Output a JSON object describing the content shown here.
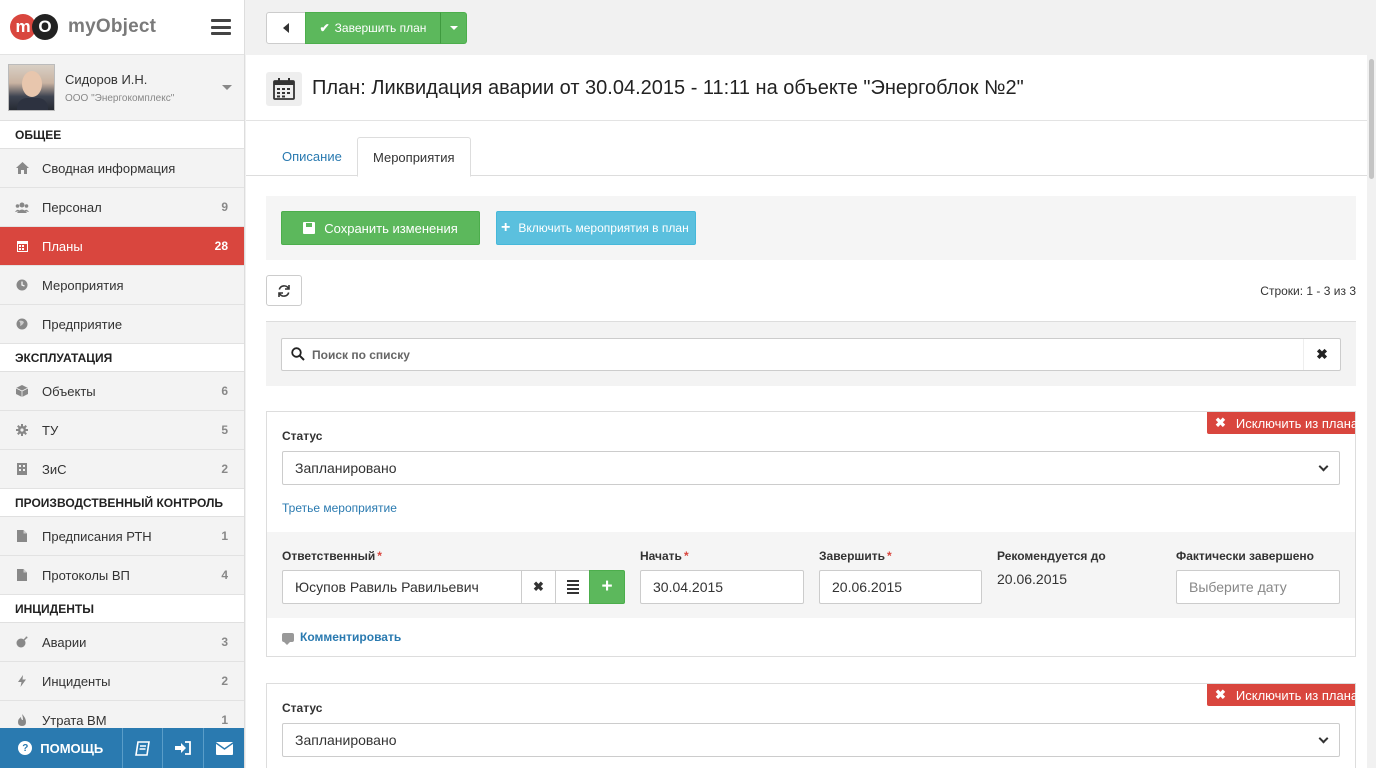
{
  "brand": {
    "logo_letter_1": "m",
    "logo_letter_2": "O",
    "name": "myObject"
  },
  "user": {
    "name": "Сидоров И.Н.",
    "org": "ООО \"Энергокомплекс\""
  },
  "sidebar": {
    "sections": [
      {
        "title": "ОБЩЕЕ",
        "items": [
          {
            "label": "Сводная информация",
            "icon": "home-icon",
            "count": ""
          },
          {
            "label": "Персонал",
            "icon": "users-icon",
            "count": "9"
          },
          {
            "label": "Планы",
            "icon": "calendar-icon",
            "count": "28",
            "active": true
          },
          {
            "label": "Мероприятия",
            "icon": "clock-icon",
            "count": ""
          },
          {
            "label": "Предприятие",
            "icon": "globe-icon",
            "count": ""
          }
        ]
      },
      {
        "title": "ЭКСПЛУАТАЦИЯ",
        "items": [
          {
            "label": "Объекты",
            "icon": "cube-icon",
            "count": "6"
          },
          {
            "label": "ТУ",
            "icon": "gear-icon",
            "count": "5"
          },
          {
            "label": "ЗиС",
            "icon": "building-icon",
            "count": "2"
          }
        ]
      },
      {
        "title": "ПРОИЗВОДСТВЕННЫЙ КОНТРОЛЬ",
        "items": [
          {
            "label": "Предписания РТН",
            "icon": "file-icon",
            "count": "1"
          },
          {
            "label": "Протоколы ВП",
            "icon": "file-icon",
            "count": "4"
          }
        ]
      },
      {
        "title": "ИНЦИДЕНТЫ",
        "items": [
          {
            "label": "Аварии",
            "icon": "bomb-icon",
            "count": "3"
          },
          {
            "label": "Инциденты",
            "icon": "bolt-icon",
            "count": "2"
          },
          {
            "label": "Утрата ВМ",
            "icon": "fire-icon",
            "count": "1"
          }
        ]
      }
    ],
    "footer": {
      "help_label": "ПОМОЩЬ"
    }
  },
  "toolbar": {
    "finish_label": "Завершить план"
  },
  "page": {
    "title": "План: Ликвидация аварии от 30.04.2015 - 11:11 на объекте \"Энергоблок №2\"",
    "tabs": [
      {
        "label": "Описание",
        "active": false
      },
      {
        "label": "Мероприятия",
        "active": true
      }
    ],
    "save_label": "Сохранить изменения",
    "include_label": "Включить мероприятия в план",
    "rows_info": "Строки: 1 - 3 из 3",
    "search_placeholder": "Поиск по списку"
  },
  "cards": [
    {
      "exclude_label": "Исключить из плана",
      "status_label": "Статус",
      "status_value": "Запланировано",
      "event_name": "Третье мероприятие",
      "responsible_label": "Ответственный",
      "responsible_value": "Юсупов Равиль Равильевич",
      "start_label": "Начать",
      "start_value": "30.04.2015",
      "end_label": "Завершить",
      "end_value": "20.06.2015",
      "recommended_label": "Рекомендуется до",
      "recommended_value": "20.06.2015",
      "actual_label": "Фактически завершено",
      "actual_placeholder": "Выберите дату",
      "comment_label": "Комментировать"
    },
    {
      "exclude_label": "Исключить из плана",
      "status_label": "Статус",
      "status_value": "Запланировано"
    }
  ],
  "colors": {
    "accent_red": "#d9463e",
    "success_green": "#5cb85c",
    "info_blue": "#5bc0de",
    "link_blue": "#2a7ab0"
  }
}
